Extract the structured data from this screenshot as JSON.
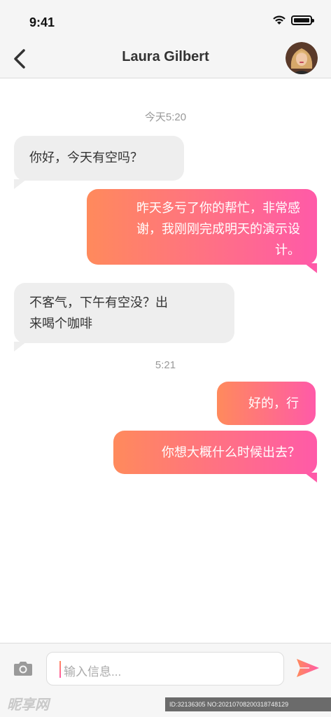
{
  "status_bar": {
    "time": "9:41"
  },
  "header": {
    "title": "Laura Gilbert"
  },
  "timestamps": [
    "今天5:20",
    "5:21"
  ],
  "messages": [
    {
      "side": "in",
      "lines": [
        "你好，今天有空吗？"
      ]
    },
    {
      "side": "out",
      "lines": [
        "昨天多亏了你的帮忙，非常感",
        "谢，我刚刚完成明天的演示设",
        "计。"
      ]
    },
    {
      "side": "in",
      "lines": [
        "不客气，下午有空没？出",
        "来喝个咖啡"
      ]
    },
    {
      "side": "out",
      "lines": [
        "好的，行"
      ]
    },
    {
      "side": "out",
      "lines": [
        "你想大概什么时候出去？"
      ]
    }
  ],
  "input": {
    "placeholder": "输入信息..."
  },
  "colors": {
    "gradient_start": "#ff8a5c",
    "gradient_end": "#ff5aa8",
    "incoming_bubble": "#eeeeee"
  },
  "icons": [
    "back-chevron-icon",
    "avatar",
    "camera-icon",
    "send-icon",
    "wifi-icon",
    "battery-icon"
  ],
  "watermark": {
    "left": "昵享网",
    "right": "ID:32136305 NO:20210708200318748129"
  }
}
